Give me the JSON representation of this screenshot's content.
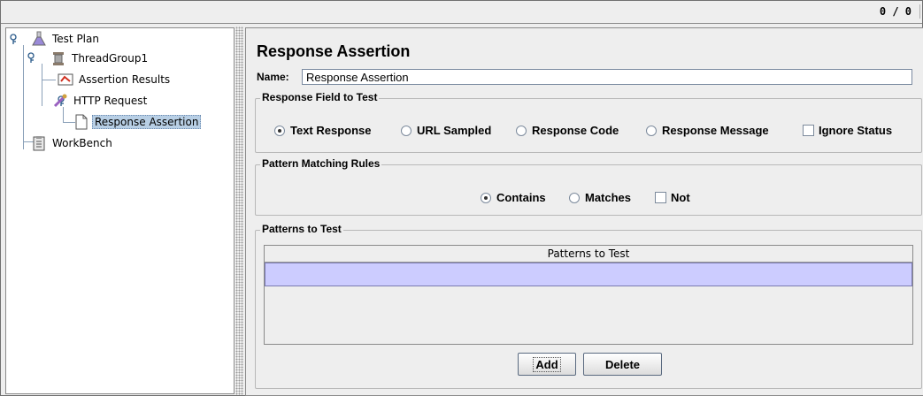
{
  "status": {
    "counter": "0 / 0"
  },
  "tree": {
    "items": [
      {
        "label": "Test Plan",
        "icon": "flask-icon"
      },
      {
        "label": "ThreadGroup1",
        "icon": "spool-icon"
      },
      {
        "label": "Assertion Results",
        "icon": "assertion-results-icon"
      },
      {
        "label": "HTTP Request",
        "icon": "pipette-icon"
      },
      {
        "label": "Response Assertion",
        "icon": "document-icon",
        "selected": true
      },
      {
        "label": "WorkBench",
        "icon": "clipboard-icon"
      }
    ]
  },
  "panel": {
    "title": "Response Assertion",
    "name_label": "Name:",
    "name_value": "Response Assertion"
  },
  "response_field": {
    "legend": "Response Field to Test",
    "options": [
      {
        "label": "Text Response",
        "selected": true
      },
      {
        "label": "URL Sampled",
        "selected": false
      },
      {
        "label": "Response Code",
        "selected": false
      },
      {
        "label": "Response Message",
        "selected": false
      }
    ],
    "ignore_status_label": "Ignore Status",
    "ignore_status_checked": false
  },
  "pattern_rules": {
    "legend": "Pattern Matching Rules",
    "contains_label": "Contains",
    "contains_selected": true,
    "matches_label": "Matches",
    "matches_selected": false,
    "not_label": "Not",
    "not_checked": false
  },
  "patterns": {
    "legend": "Patterns to Test",
    "column_header": "Patterns to Test",
    "rows": [
      ""
    ]
  },
  "buttons": {
    "add": "Add",
    "delete": "Delete"
  },
  "colors": {
    "selection": "#b8cfe5",
    "table_row": "#ccccff",
    "background": "#eeeeee"
  }
}
